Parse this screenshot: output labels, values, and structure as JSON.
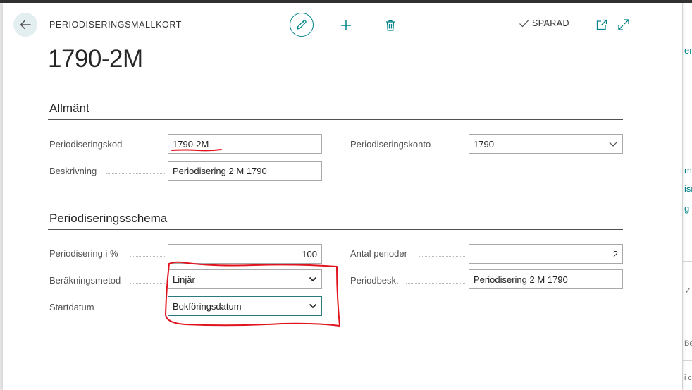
{
  "header": {
    "caption": "PERIODISERINGSMALLKORT",
    "saved_label": "SPARAD",
    "record_title": "1790-2M"
  },
  "general": {
    "title": "Allmänt",
    "code_label": "Periodiseringskod",
    "code_value": "1790-2M",
    "account_label": "Periodiseringskonto",
    "account_value": "1790",
    "description_label": "Beskrivning",
    "description_value": "Periodisering 2 M 1790"
  },
  "schedule": {
    "title": "Periodiseringsschema",
    "percent_label": "Periodisering i %",
    "percent_value": "100",
    "periods_label": "Antal perioder",
    "periods_value": "2",
    "method_label": "Beräkningsmetod",
    "method_value": "Linjär",
    "period_desc_label": "Periodbesk.",
    "period_desc_value": "Periodisering 2 M 1790",
    "start_label": "Startdatum",
    "start_value": "Bokföringsdatum"
  },
  "background": {
    "peek": [
      "er",
      "m",
      "isr",
      "g",
      "Be",
      "i c"
    ]
  },
  "colors": {
    "accent": "#00838a",
    "annotation": "#e0141e",
    "focus_border": "#2a7a7f"
  },
  "icons": [
    "back-arrow-icon",
    "edit-pencil-icon",
    "plus-icon",
    "trash-icon",
    "checkmark-icon",
    "popout-icon",
    "expand-icon",
    "chevron-down-icon"
  ]
}
